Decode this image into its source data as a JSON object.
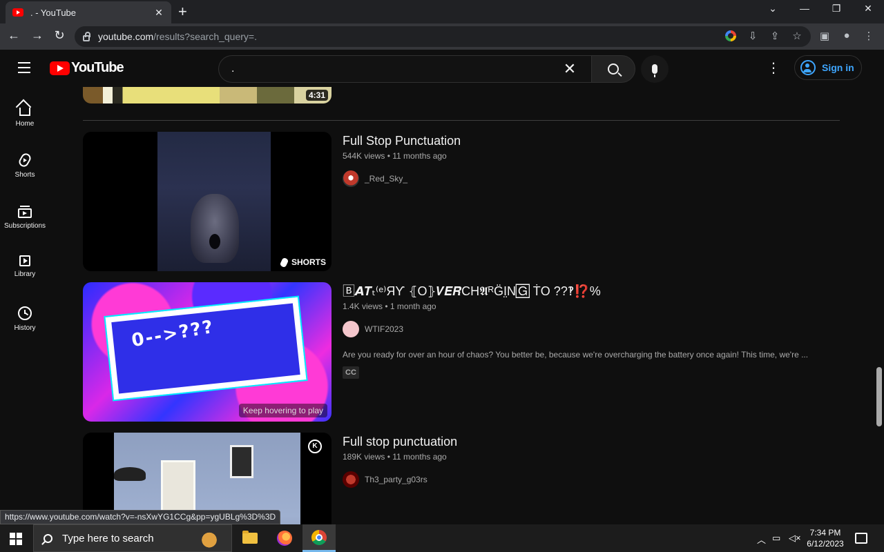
{
  "browser": {
    "tab_title": ". - YouTube",
    "tab_close": "✕",
    "new_tab": "+",
    "url_host": "youtube.com",
    "url_path": "/results?search_query=.",
    "status_url": "https://www.youtube.com/watch?v=-nsXwYG1CCg&pp=ygUBLg%3D%3D"
  },
  "masthead": {
    "logo_text": "YouTube",
    "search_query": ".",
    "clear_glyph": "✕",
    "more_glyph": "⋮",
    "signin_label": "Sign in"
  },
  "guide": {
    "items": [
      {
        "label": "Home",
        "icon": "home-icon"
      },
      {
        "label": "Shorts",
        "icon": "shorts-icon"
      },
      {
        "label": "Subscriptions",
        "icon": "subscriptions-icon"
      },
      {
        "label": "Library",
        "icon": "library-icon"
      },
      {
        "label": "History",
        "icon": "history-icon"
      }
    ]
  },
  "results": {
    "previous_duration": "4:31",
    "videos": [
      {
        "title": "Full Stop Punctuation",
        "stats": "544K views • 11 months ago",
        "channel": "_Red_Sky_",
        "badge": "SHORTS",
        "avatar_color": "#c0392b"
      },
      {
        "title": "🄱𝘼𝑻ₜ⁽ᵉ⁾ЯƳ ⦃O⦄𝑽𝑬𝑹CH𝕬ᴿG̈I̤N🄶 ṪO ??‽⁉️%",
        "stats": "1.4K views • 1 month ago",
        "channel": "WTIF2023",
        "description": "Are you ready for over an hour of chaos? You better be, because we're overcharging the battery once again! This time, we're ...",
        "cc_badge": "CC",
        "hover_hint": "Keep hovering to play",
        "thumb_text": "0-->???",
        "avatar_color": "#f4c6cc"
      },
      {
        "title": "Full stop punctuation",
        "stats": "189K views • 11 months ago",
        "channel": "Th3_party_g03rs",
        "thumb_logo": "K",
        "avatar_color": "#8b0000"
      }
    ]
  },
  "taskbar": {
    "search_placeholder": "Type here to search",
    "time": "7:34 PM",
    "date": "6/12/2023"
  },
  "colors": {
    "yt_red": "#ff0000",
    "link_blue": "#3ea6ff",
    "background": "#0f0f0f"
  }
}
